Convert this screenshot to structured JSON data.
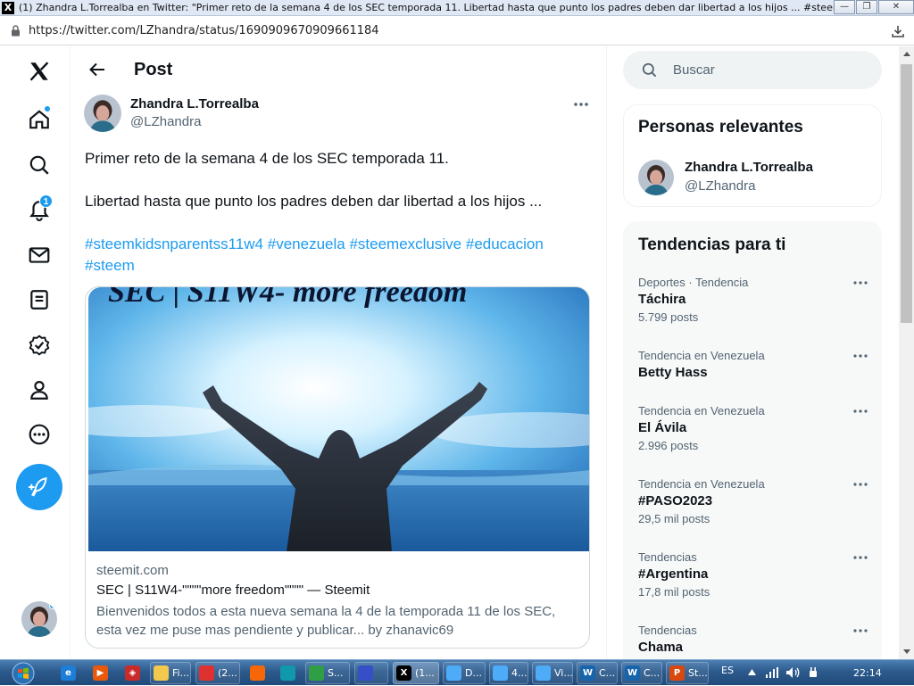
{
  "window": {
    "title": "(1) Zhandra L.Torrealba en Twitter: \"Primer reto de la semana 4 de los SEC temporada 11. Libertad hasta que punto los padres deben dar libertad a los hijos ... #steemkid...",
    "url": "https://twitter.com/LZhandra/status/1690909670909661184"
  },
  "nav": {
    "notifications_badge": "1",
    "accent": "#1d9bf0"
  },
  "header": {
    "title": "Post"
  },
  "post": {
    "author_name": "Zhandra L.Torrealba",
    "author_handle": "@LZhandra",
    "line1": "Primer reto de la semana 4 de los SEC temporada 11.",
    "line2": "Libertad hasta que punto los padres deben dar libertad a los hijos ...",
    "hashtags": [
      "#steemkidsnparentss11w4",
      "#venezuela",
      "#steemexclusive",
      "#educacion",
      "#steem"
    ],
    "card": {
      "image_text": "SEC | S11W4-  more freedom",
      "domain": "steemit.com",
      "title": "SEC | S11W4-\"\"\"\"more freedom\"\"\"\" — Steemit",
      "description": "Bienvenidos todos a esta nueva semana la 4 de la temporada 11 de los SEC, esta vez me puse mas pendiente y publicar... by zhanavic69"
    }
  },
  "sidebar": {
    "search_placeholder": "Buscar",
    "relevant_title": "Personas relevantes",
    "relevant_name": "Zhandra L.Torrealba",
    "relevant_handle": "@LZhandra",
    "trends_title": "Tendencias para ti",
    "trends": [
      {
        "category": "Deportes · Tendencia",
        "name": "Táchira",
        "count": "5.799 posts"
      },
      {
        "category": "Tendencia en Venezuela",
        "name": "Betty Hass",
        "count": ""
      },
      {
        "category": "Tendencia en Venezuela",
        "name": "El Ávila",
        "count": "2.996 posts"
      },
      {
        "category": "Tendencia en Venezuela",
        "name": "#PASO2023",
        "count": "29,5 mil posts"
      },
      {
        "category": "Tendencias",
        "name": "#Argentina",
        "count": "17,8 mil posts"
      },
      {
        "category": "Tendencias",
        "name": "Chama",
        "count": ""
      }
    ]
  },
  "taskbar": {
    "items": [
      "Fi...",
      "(2...",
      "",
      "",
      "S...",
      "",
      "(1...",
      "D...",
      "4...",
      "Vi...",
      "C...",
      "C...",
      "St..."
    ],
    "language": "ES",
    "time": "22:14"
  }
}
